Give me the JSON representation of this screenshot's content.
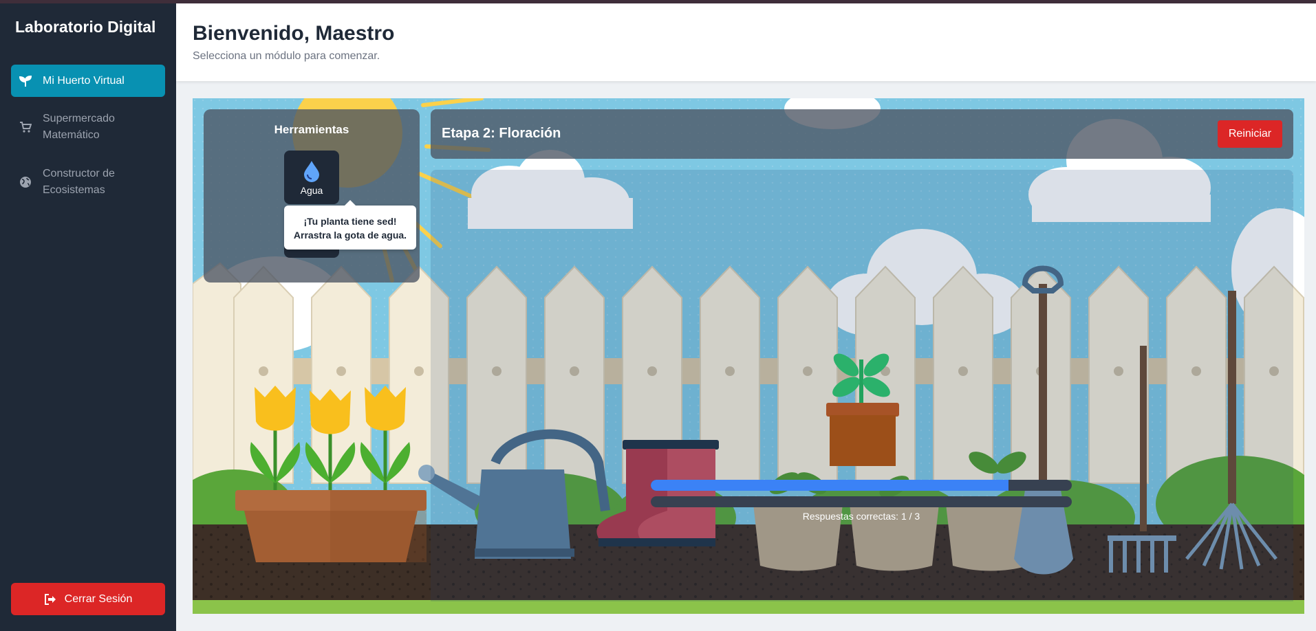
{
  "sidebar": {
    "brand": "Laboratorio Digital",
    "items": [
      {
        "label": "Mi Huerto Virtual",
        "icon": "seedling-icon",
        "active": true
      },
      {
        "label": "Supermercado Matemático",
        "icon": "cart-icon",
        "active": false
      },
      {
        "label": "Constructor de Ecosistemas",
        "icon": "globe-icon",
        "active": false
      }
    ],
    "logout_label": "Cerrar Sesión"
  },
  "header": {
    "title": "Bienvenido, Maestro",
    "subtitle": "Selecciona un módulo para comenzar."
  },
  "game": {
    "tools_title": "Herramientas",
    "tools": [
      {
        "label": "Agua",
        "icon": "water-drop-icon"
      }
    ],
    "tooltip_line1": "¡Tu planta tiene sed!",
    "tooltip_line2": "Arrastra la gota de agua.",
    "stage_title": "Etapa 2: Floración",
    "restart_label": "Reiniciar",
    "growth_progress": 0.85,
    "water_progress": 0,
    "answers_text": "Respuestas correctas: 1 / 3"
  },
  "colors": {
    "sidebar_bg": "#1f2937",
    "accent": "#0891b2",
    "danger": "#dc2626",
    "progress": "#3b82f6"
  }
}
